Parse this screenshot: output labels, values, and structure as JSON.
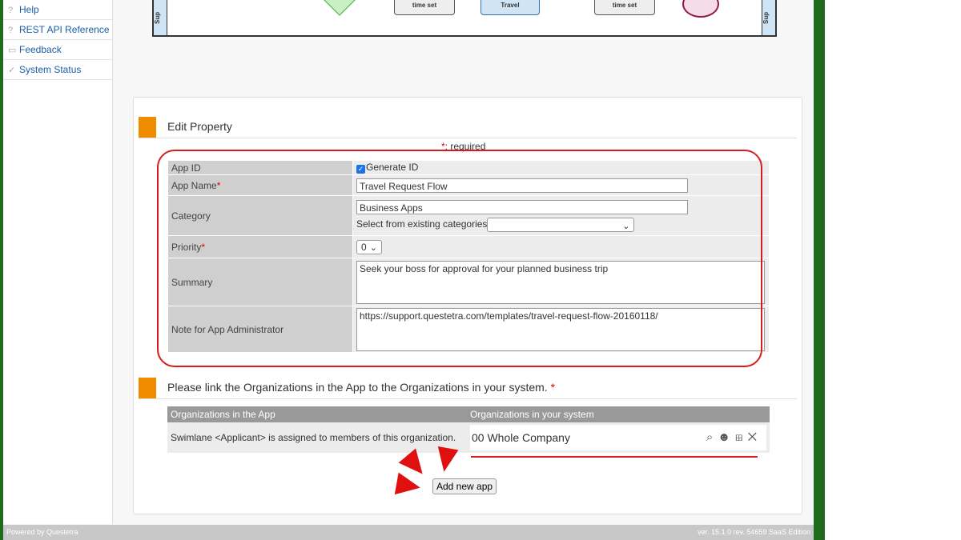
{
  "sidebar": {
    "items": [
      {
        "label": "Help",
        "icon": "question-icon"
      },
      {
        "label": "REST API Reference",
        "icon": "question-icon"
      },
      {
        "label": "Feedback",
        "icon": "chat-icon"
      },
      {
        "label": "System Status",
        "icon": "check-circle-icon"
      }
    ]
  },
  "diagram": {
    "lane_left": "Sup",
    "lane_right": "Sup",
    "node1": "time set",
    "node2": "Travel",
    "node3": "time set"
  },
  "edit_property": {
    "title": "Edit Property",
    "required_note": ": required",
    "required_mark": "*",
    "rows": {
      "app_id": {
        "label": "App ID",
        "checkbox_label": "Generate ID",
        "checked": true
      },
      "app_name": {
        "label": "App Name",
        "value": "Travel Request Flow"
      },
      "category": {
        "label": "Category",
        "value": "Business Apps",
        "select_label": "Select from existing categories",
        "select_value": ""
      },
      "priority": {
        "label": "Priority",
        "value": "0"
      },
      "summary": {
        "label": "Summary",
        "value": "Seek your boss for approval for your planned business trip"
      },
      "note": {
        "label": "Note for App Administrator",
        "value": "https://support.questetra.com/templates/travel-request-flow-20160118/"
      }
    }
  },
  "orgs": {
    "title": "Please link the Organizations in the App to the Organizations in your system.",
    "col1": "Organizations in the App",
    "col2": "Organizations in your system",
    "row_text": "Swimlane <Applicant> is assigned to members of this organization.",
    "row_value": "00 Whole Company"
  },
  "add_button": "Add new app",
  "footer": {
    "left": "Powered by Questetra",
    "right": "ver. 15.1.0 rev. 54659 SaaS Edition"
  },
  "colors": {
    "accent": "#f08c00",
    "highlight": "#d81b1b",
    "frame": "#1f6b1b"
  }
}
